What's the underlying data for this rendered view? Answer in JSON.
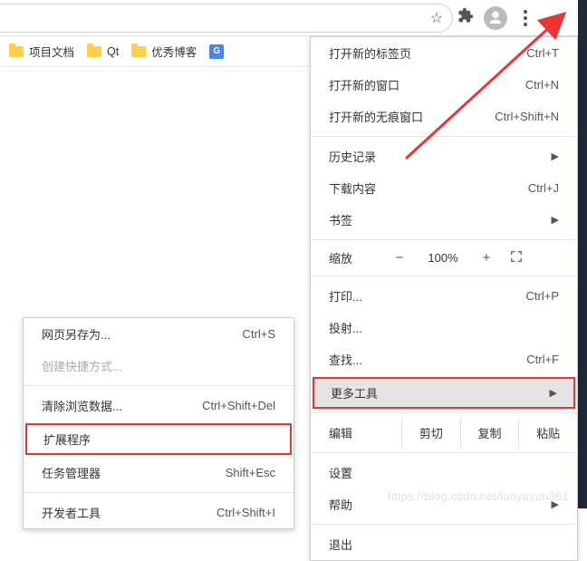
{
  "toolbar": {
    "star_alt": "bookmark-star"
  },
  "bookmarks": {
    "items": [
      {
        "label": "项目文档"
      },
      {
        "label": "Qt"
      },
      {
        "label": "优秀博客"
      }
    ]
  },
  "main_menu": {
    "new_tab": {
      "label": "打开新的标签页",
      "shortcut": "Ctrl+T"
    },
    "new_window": {
      "label": "打开新的窗口",
      "shortcut": "Ctrl+N"
    },
    "incognito": {
      "label": "打开新的无痕窗口",
      "shortcut": "Ctrl+Shift+N"
    },
    "history": {
      "label": "历史记录"
    },
    "downloads": {
      "label": "下载内容",
      "shortcut": "Ctrl+J"
    },
    "bookmarks": {
      "label": "书签"
    },
    "zoom": {
      "label": "缩放",
      "minus": "−",
      "value": "100%",
      "plus": "+"
    },
    "print": {
      "label": "打印...",
      "shortcut": "Ctrl+P"
    },
    "cast": {
      "label": "投射..."
    },
    "find": {
      "label": "查找...",
      "shortcut": "Ctrl+F"
    },
    "more_tools": {
      "label": "更多工具"
    },
    "edit": {
      "label": "编辑",
      "cut": "剪切",
      "copy": "复制",
      "paste": "粘贴"
    },
    "settings": {
      "label": "设置"
    },
    "help": {
      "label": "帮助"
    },
    "exit": {
      "label": "退出"
    }
  },
  "sub_menu": {
    "save_as": {
      "label": "网页另存为...",
      "shortcut": "Ctrl+S"
    },
    "create_shortcut": {
      "label": "创建快捷方式..."
    },
    "clear_data": {
      "label": "清除浏览数据...",
      "shortcut": "Ctrl+Shift+Del"
    },
    "extensions": {
      "label": "扩展程序"
    },
    "task_manager": {
      "label": "任务管理器",
      "shortcut": "Shift+Esc"
    },
    "dev_tools": {
      "label": "开发者工具",
      "shortcut": "Ctrl+Shift+I"
    }
  },
  "watermark": "https://blog.csdn.net/luoyayun361"
}
